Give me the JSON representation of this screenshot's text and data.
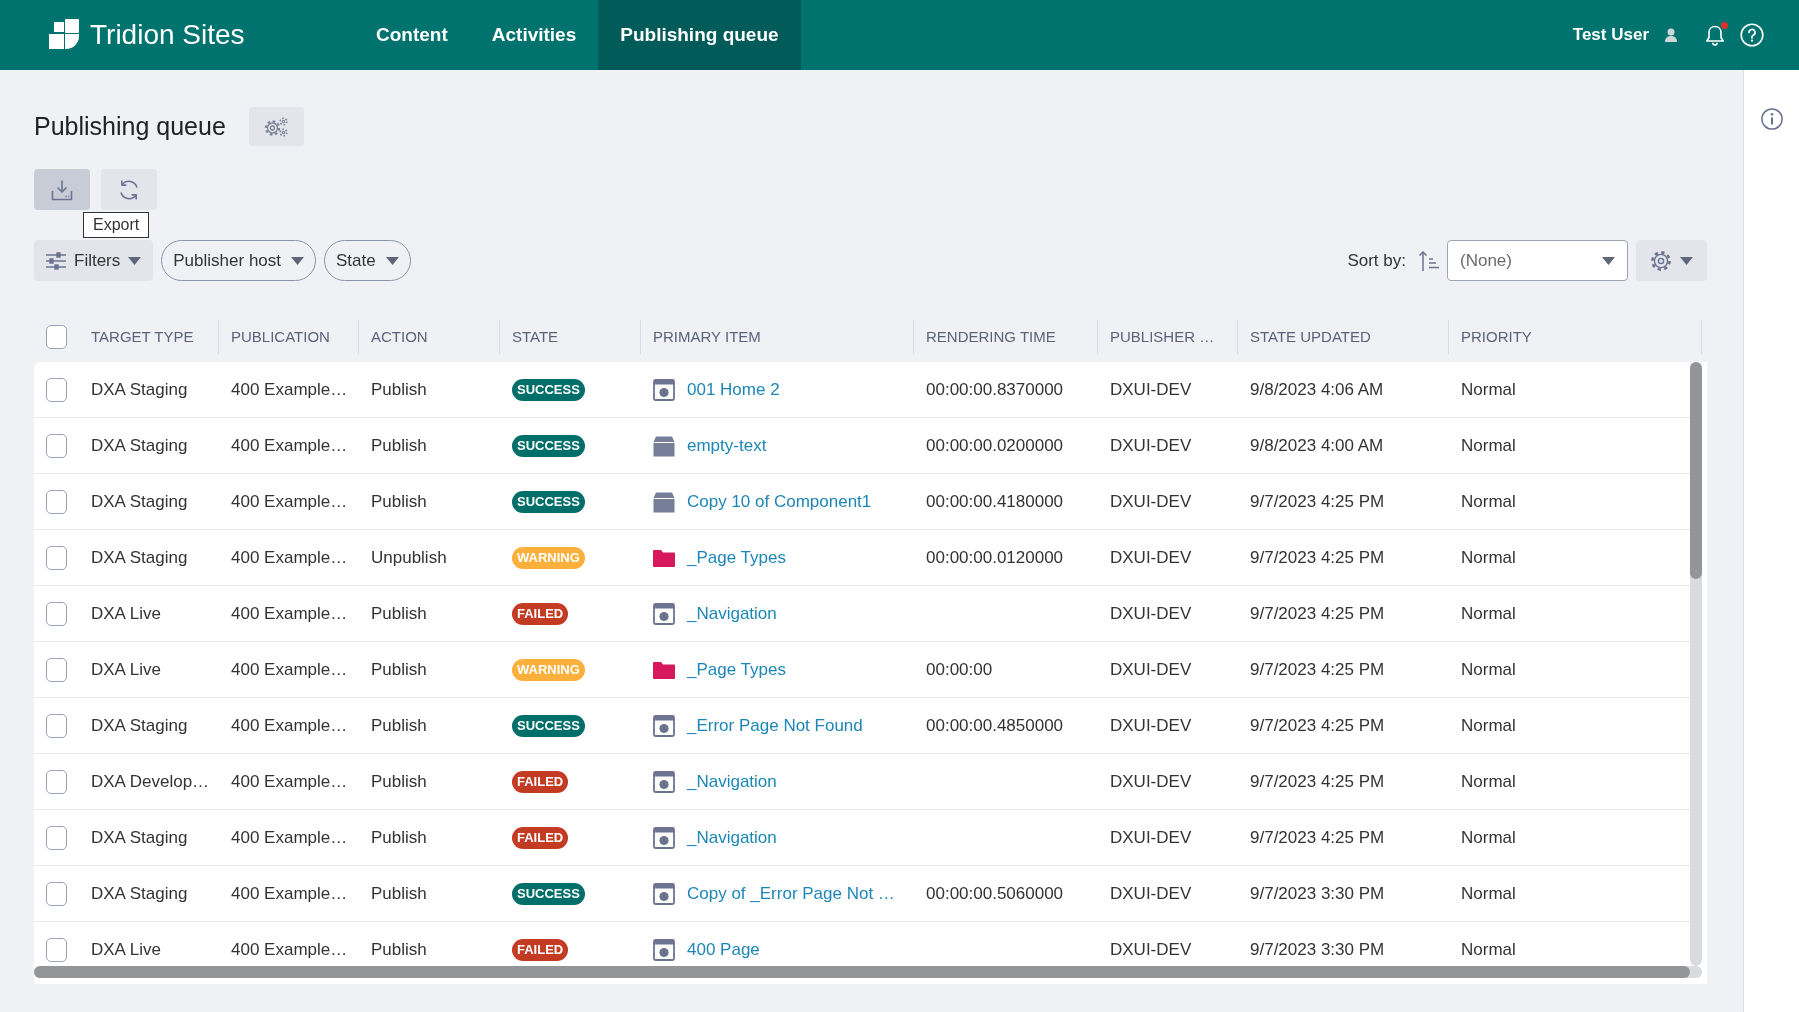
{
  "header": {
    "product": "Tridion Sites",
    "nav": [
      {
        "label": "Content",
        "selected": false
      },
      {
        "label": "Activities",
        "selected": false
      },
      {
        "label": "Publishing queue",
        "selected": true
      }
    ],
    "user": "Test User",
    "notifications_unread": true
  },
  "page": {
    "title": "Publishing queue"
  },
  "toolbar": {
    "buttons": [
      {
        "kind": "export",
        "hovered": true
      },
      {
        "kind": "refresh",
        "hovered": false
      }
    ],
    "tooltip": "Export"
  },
  "filters": [
    {
      "kind": "panel",
      "label": "Filters"
    },
    {
      "kind": "pill",
      "label": "Publisher host"
    },
    {
      "kind": "pill",
      "label": "State"
    }
  ],
  "sort": {
    "label": "Sort by:",
    "value": "(None)"
  },
  "table": {
    "all_checked": false,
    "columns": [
      "TARGET TYPE",
      "PUBLICATION",
      "ACTION",
      "STATE",
      "PRIMARY ITEM",
      "RENDERING TIME",
      "PUBLISHER …",
      "STATE UPDATED",
      "PRIORITY"
    ],
    "rows": [
      {
        "checked": false,
        "target_type": "DXA Staging",
        "publication": "400 Example…",
        "action": "Publish",
        "state": {
          "text": "SUCCESS",
          "color": "#006f6a"
        },
        "primary_item": {
          "text": "001 Home 2",
          "kind": "page"
        },
        "rendering_time": "00:00:00.8370000",
        "publisher": "DXUI-DEV",
        "state_updated": "9/8/2023 4:06 AM",
        "priority": "Normal"
      },
      {
        "checked": false,
        "target_type": "DXA Staging",
        "publication": "400 Example…",
        "action": "Publish",
        "state": {
          "text": "SUCCESS",
          "color": "#006f6a"
        },
        "primary_item": {
          "text": "empty-text",
          "kind": "component"
        },
        "rendering_time": "00:00:00.0200000",
        "publisher": "DXUI-DEV",
        "state_updated": "9/8/2023 4:00 AM",
        "priority": "Normal"
      },
      {
        "checked": false,
        "target_type": "DXA Staging",
        "publication": "400 Example…",
        "action": "Publish",
        "state": {
          "text": "SUCCESS",
          "color": "#006f6a"
        },
        "primary_item": {
          "text": "Copy 10 of Component1",
          "kind": "component"
        },
        "rendering_time": "00:00:00.4180000",
        "publisher": "DXUI-DEV",
        "state_updated": "9/7/2023 4:25 PM",
        "priority": "Normal"
      },
      {
        "checked": false,
        "target_type": "DXA Staging",
        "publication": "400 Example…",
        "action": "Unpublish",
        "state": {
          "text": "WARNING",
          "color": "#fbb03b"
        },
        "primary_item": {
          "text": "_Page Types",
          "kind": "folder"
        },
        "rendering_time": "00:00:00.0120000",
        "publisher": "DXUI-DEV",
        "state_updated": "9/7/2023 4:25 PM",
        "priority": "Normal"
      },
      {
        "checked": false,
        "target_type": "DXA Live",
        "publication": "400 Example…",
        "action": "Publish",
        "state": {
          "text": "FAILED",
          "color": "#c23b22"
        },
        "primary_item": {
          "text": "_Navigation",
          "kind": "page"
        },
        "publisher": "DXUI-DEV",
        "state_updated": "9/7/2023 4:25 PM",
        "priority": "Normal"
      },
      {
        "checked": false,
        "target_type": "DXA Live",
        "publication": "400 Example…",
        "action": "Publish",
        "state": {
          "text": "WARNING",
          "color": "#fbb03b"
        },
        "primary_item": {
          "text": "_Page Types",
          "kind": "folder"
        },
        "rendering_time": "00:00:00",
        "publisher": "DXUI-DEV",
        "state_updated": "9/7/2023 4:25 PM",
        "priority": "Normal"
      },
      {
        "checked": false,
        "target_type": "DXA Staging",
        "publication": "400 Example…",
        "action": "Publish",
        "state": {
          "text": "SUCCESS",
          "color": "#006f6a"
        },
        "primary_item": {
          "text": "_Error Page Not Found",
          "kind": "page"
        },
        "rendering_time": "00:00:00.4850000",
        "publisher": "DXUI-DEV",
        "state_updated": "9/7/2023 4:25 PM",
        "priority": "Normal"
      },
      {
        "checked": false,
        "target_type": "DXA Develop…",
        "publication": "400 Example…",
        "action": "Publish",
        "state": {
          "text": "FAILED",
          "color": "#c23b22"
        },
        "primary_item": {
          "text": "_Navigation",
          "kind": "page"
        },
        "publisher": "DXUI-DEV",
        "state_updated": "9/7/2023 4:25 PM",
        "priority": "Normal"
      },
      {
        "checked": false,
        "target_type": "DXA Staging",
        "publication": "400 Example…",
        "action": "Publish",
        "state": {
          "text": "FAILED",
          "color": "#c23b22"
        },
        "primary_item": {
          "text": "_Navigation",
          "kind": "page"
        },
        "publisher": "DXUI-DEV",
        "state_updated": "9/7/2023 4:25 PM",
        "priority": "Normal"
      },
      {
        "checked": false,
        "target_type": "DXA Staging",
        "publication": "400 Example…",
        "action": "Publish",
        "state": {
          "text": "SUCCESS",
          "color": "#006f6a"
        },
        "primary_item": {
          "text": "Copy of _Error Page Not …",
          "kind": "page"
        },
        "rendering_time": "00:00:00.5060000",
        "publisher": "DXUI-DEV",
        "state_updated": "9/7/2023 3:30 PM",
        "priority": "Normal"
      },
      {
        "checked": false,
        "target_type": "DXA Live",
        "publication": "400 Example…",
        "action": "Publish",
        "state": {
          "text": "FAILED",
          "color": "#c23b22"
        },
        "primary_item": {
          "text": "400 Page",
          "kind": "page"
        },
        "publisher": "DXUI-DEV",
        "state_updated": "9/7/2023 3:30 PM",
        "priority": "Normal"
      }
    ]
  }
}
